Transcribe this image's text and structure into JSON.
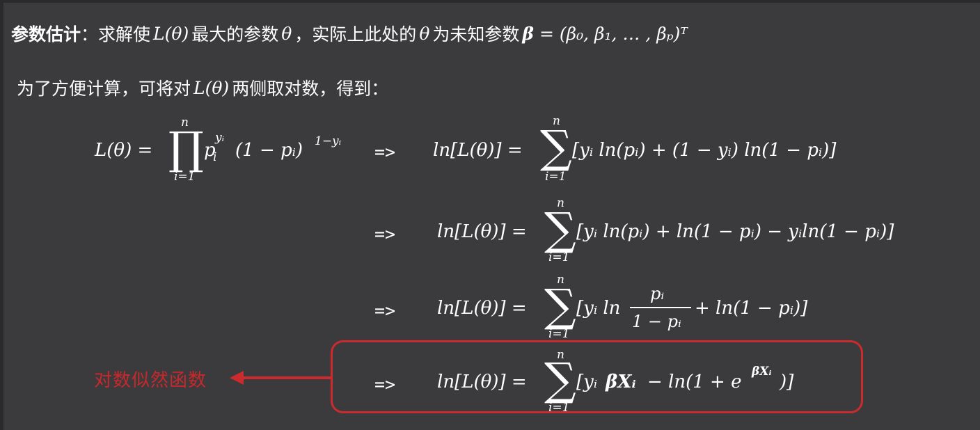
{
  "header": {
    "title_bold": "参数估计",
    "colon": "：",
    "text_a": "求解使",
    "math_L": "L(θ)",
    "text_b": "最大的参数",
    "math_theta": "θ",
    "text_c": "，实际上此处的",
    "math_theta2": "θ",
    "text_d": "为未知参数",
    "math_beta": "β",
    "math_beta_def": "= (β₀, β₁, … , βₚ)ᵀ"
  },
  "intro": {
    "text_a": "为了方便计算，可将对",
    "math_L": "L(θ)",
    "text_b": "两侧取对数，得到："
  },
  "equations": {
    "eq1_lhs": "L(θ) =",
    "eq1_prod": "∏",
    "eq1_prod_top": "n",
    "eq1_prod_bottom": "i=1",
    "eq1_rhs_p": "p",
    "eq1_rhs_p_sub": "i",
    "eq1_rhs_p_sup": "yᵢ",
    "eq1_rhs_rest": "(1 − pᵢ)",
    "eq1_rhs_rest_sup": "1−yᵢ",
    "arrow": "=>",
    "eq1_log_lhs": "ln[L(θ)] =",
    "sum": "∑",
    "sum_top": "n",
    "sum_bottom": "i=1",
    "eq1_log_rhs": "[yᵢ ln(pᵢ) + (1 − yᵢ) ln(1 − pᵢ)]",
    "eq2_lhs": "ln[L(θ)] =",
    "eq2_rhs": "[yᵢ ln(pᵢ) + ln(1 − pᵢ) − yᵢln(1 − pᵢ)]",
    "eq3_lhs": "ln[L(θ)] =",
    "eq3_rhs_a": "[yᵢ ln",
    "eq3_frac_num": "pᵢ",
    "eq3_frac_den": "1 − pᵢ",
    "eq3_rhs_b": "+ ln(1 − pᵢ)]",
    "eq4_lhs": "ln[L(θ)] =",
    "eq4_rhs_a": "[yᵢ",
    "eq4_rhs_bold": "βXᵢ",
    "eq4_rhs_b": "− ln(1 + e",
    "eq4_rhs_sup": "βXᵢ",
    "eq4_rhs_c": ")]"
  },
  "callout": {
    "label": "对数似然函数",
    "color": "#c9282b"
  },
  "colors": {
    "background": "#3b3b3e",
    "text": "#ffffff",
    "accent": "#cc2b2e"
  }
}
